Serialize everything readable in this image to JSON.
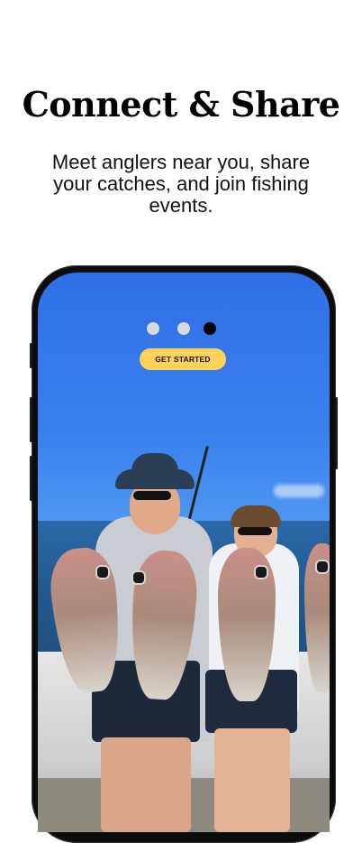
{
  "onboarding": {
    "title": "Connect & Share",
    "subtitle": "Meet anglers near you, share your catches, and join fishing events.",
    "cta_label": "GET STARTED",
    "pagination": {
      "total": 3,
      "active_index": 2
    },
    "colors": {
      "cta_background": "#ffd25a",
      "dot_active": "#000000",
      "dot_inactive": "#d9d9d9"
    }
  },
  "image": {
    "subject": "two anglers holding caught fish on a boat"
  }
}
